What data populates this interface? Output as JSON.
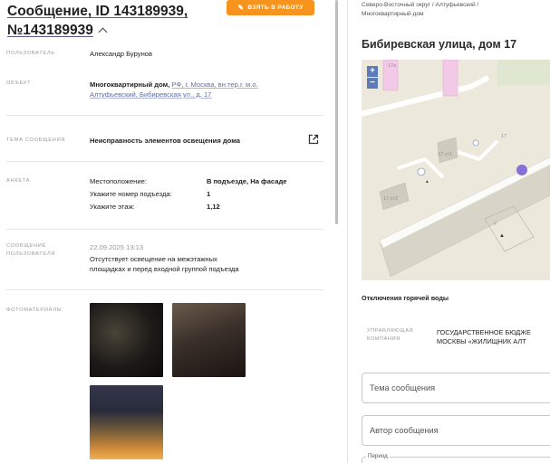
{
  "message": {
    "title_prefix": "Сообщение, ID 143189939,",
    "title_number": "№143189939",
    "take_button": "ВЗЯТЬ В РАБОТУ"
  },
  "details": {
    "user_label": "ПОЛЬЗОВАТЕЛЬ",
    "user_value": "Александр Бурунов",
    "object_label": "ОБЪЕКТ",
    "object_type": "Многоквартирный дом,",
    "object_address_1": "РФ, г. Москва, вн.тер.г. м.о.",
    "object_address_2": "Алтуфьевский, Бибиревская ул., д. 17",
    "topic_label": "ТЕМА СООБЩЕНИЯ",
    "topic_value": "Неисправность элементов освещения дома",
    "anketa_label": "АНКЕТА",
    "anketa": [
      {
        "key": "Местоположение:",
        "value": "В подъезде, На фасаде"
      },
      {
        "key": "Укажите номер подъезда:",
        "value": "1"
      },
      {
        "key": "Укажите этаж:",
        "value": "1,12"
      }
    ],
    "user_msg_label_1": "СООБЩЕНИЕ",
    "user_msg_label_2": "ПОЛЬЗОВАТЕЛЯ",
    "user_msg_date": "22.09.2025 13:13",
    "user_msg_text_1": "Отсутствует освещение на межэтажных",
    "user_msg_text_2": "площадках и перед входной группой подъезда",
    "photos_label": "ФОТОМАТЕРИАЛЫ"
  },
  "right": {
    "breadcrumb_1": "Северо-Восточный округ / Алтуфьевский /",
    "breadcrumb_2": "Многоквартирный дом",
    "address_title": "Бибиревская улица, дом 17",
    "map_labels": {
      "b1": "17а",
      "b2": "17 ст1",
      "b3": "17 ст2",
      "b4": "17",
      "b5": "д"
    },
    "zoom_in": "+",
    "zoom_out": "−",
    "outage": "Отключения горячей воды",
    "uk_label_1": "УПРАВЛЯЮЩАЯ",
    "uk_label_2": "КОМПАНИЯ",
    "uk_value_1": "ГОСУДАРСТВЕННОЕ БЮДЖЕ",
    "uk_value_2": "МОСКВЫ «ЖИЛИЩНИК АЛТ",
    "topic_placeholder": "Тема сообщения",
    "author_placeholder": "Автор сообщения",
    "period_label": "Период"
  },
  "colors": {
    "accent": "#f7941d",
    "link": "#5f6ea8",
    "map_zoom": "#5d7ab8",
    "map_marker": "#8a6fd9"
  }
}
